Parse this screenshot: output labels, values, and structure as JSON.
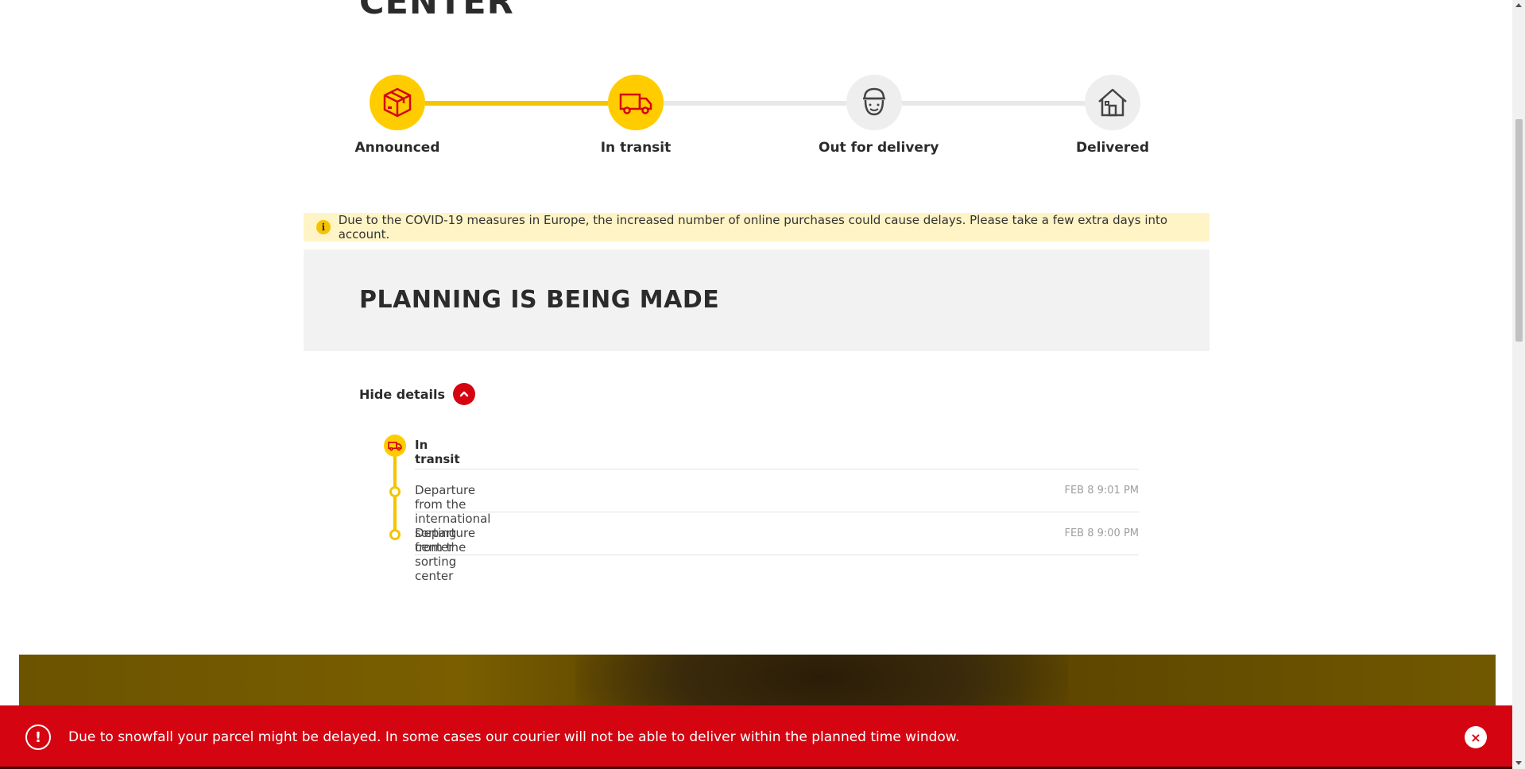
{
  "page": {
    "title": "CENTER"
  },
  "progress": {
    "steps": [
      {
        "label": "Announced",
        "icon": "package-icon",
        "state": "done"
      },
      {
        "label": "In transit",
        "icon": "truck-icon",
        "state": "done"
      },
      {
        "label": "Out for delivery",
        "icon": "courier-icon",
        "state": "pending"
      },
      {
        "label": "Delivered",
        "icon": "house-icon",
        "state": "pending"
      }
    ]
  },
  "notice": {
    "icon": "i",
    "text": "Due to the COVID-19 measures in Europe, the increased number of online purchases could cause delays. Please take a few extra days into account."
  },
  "status": {
    "heading": "PLANNING IS BEING MADE"
  },
  "details": {
    "toggle_label": "Hide details"
  },
  "timeline": {
    "group_title": "In transit",
    "events": [
      {
        "text": "Departure from the international sorting center",
        "time": "FEB 8 9:01 PM"
      },
      {
        "text": "Departure from the sorting center",
        "time": "FEB 8 9:00 PM"
      }
    ]
  },
  "alert": {
    "icon": "!",
    "message": "Due to snowfall your parcel might be delayed. In some cases our courier will not be able to deliver within the planned time window.",
    "close": "×"
  },
  "colors": {
    "brand_yellow": "#ffcc00",
    "brand_red": "#d40511",
    "notice_bg": "#fff4c6"
  }
}
